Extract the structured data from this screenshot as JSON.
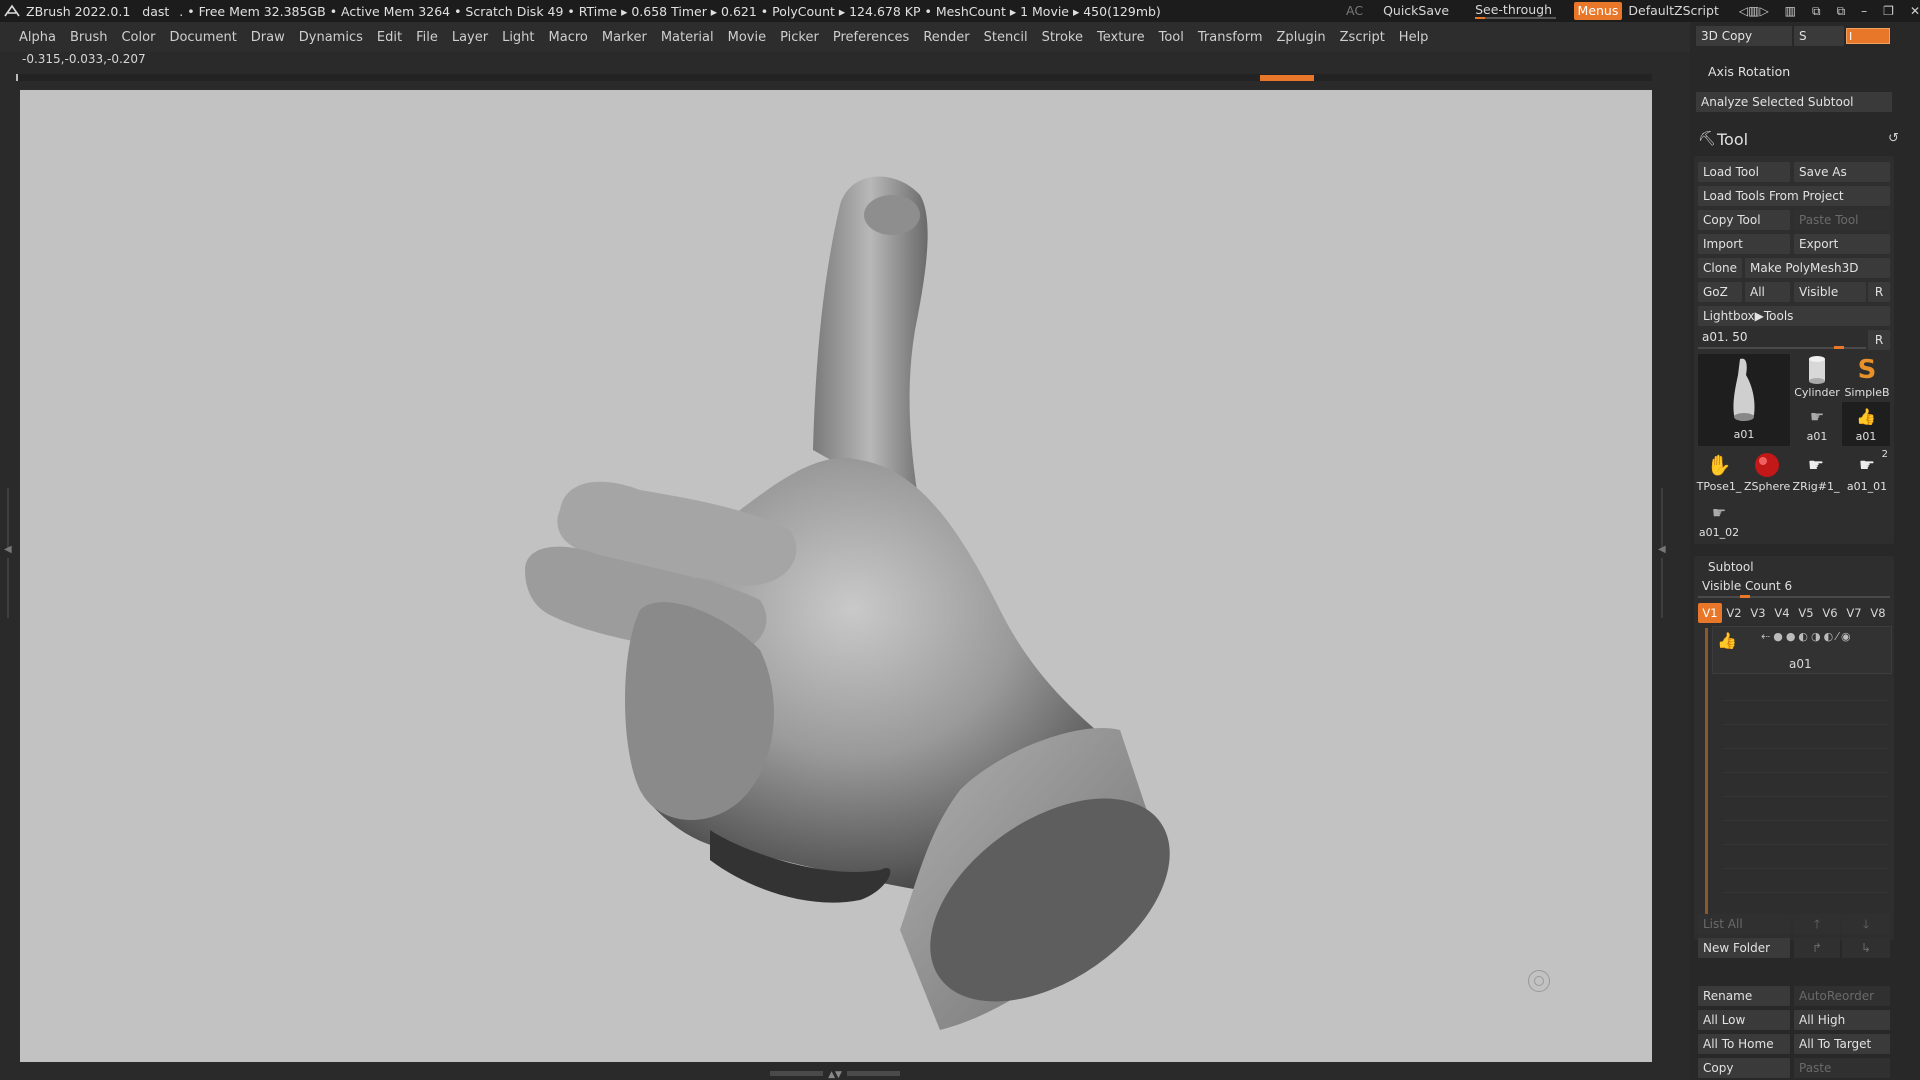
{
  "titlebar": {
    "app_name": "ZBrush 2022.0.1",
    "doc_name": "dast",
    "stats": ". • Free Mem 32.385GB • Active Mem 3264 • Scratch Disk 49 •  RTime ▸ 0.658 Timer ▸ 0.621 • PolyCount ▸ 124.678 KP  • MeshCount ▸ 1  Movie ▸ 450(129mb)",
    "ac": "AC",
    "quicksave": "QuickSave",
    "see_through_label": "See-through",
    "see_through_value": "0",
    "menus": "Menus",
    "zscript": "DefaultZScript"
  },
  "menubar": {
    "items": [
      "Alpha",
      "Brush",
      "Color",
      "Document",
      "Draw",
      "Dynamics",
      "Edit",
      "File",
      "Layer",
      "Light",
      "Macro",
      "Marker",
      "Material",
      "Movie",
      "Picker",
      "Preferences",
      "Render",
      "Stencil",
      "Stroke",
      "Texture",
      "Tool",
      "Transform",
      "Zplugin",
      "Zscript",
      "Help"
    ]
  },
  "coords": "-0.315,-0.033,-0.207",
  "panel": {
    "copy3d": "3D Copy",
    "s_label": "S",
    "i_label": "I",
    "axis_rotation": "Axis Rotation",
    "analyze": "Analyze Selected Subtool",
    "tool_title": "Tool",
    "load_tool": "Load Tool",
    "save_as": "Save As",
    "load_from_project": "Load Tools From Project",
    "copy_tool": "Copy Tool",
    "paste_tool": "Paste Tool",
    "import": "Import",
    "export": "Export",
    "clone": "Clone",
    "make_polymesh": "Make PolyMesh3D",
    "goz": "GoZ",
    "all": "All",
    "visible": "Visible",
    "r": "R",
    "lightbox_tools": "Lightbox▶Tools",
    "tool_slider_label": "a01. 50",
    "thumbs": {
      "main": "a01",
      "cylinder": "Cylinder",
      "simpleb": "SimpleB",
      "a01_small": "a01",
      "a01_small2": "a01",
      "tpose": "TPose1_",
      "zsphere": "ZSphere",
      "zrig": "ZRig#1_",
      "a01_01": "a01_01",
      "a01_01_count": "2",
      "a01_02": "a01_02"
    },
    "subtool_title": "Subtool",
    "visible_count": "Visible Count 6",
    "vtabs": [
      "V1",
      "V2",
      "V3",
      "V4",
      "V5",
      "V6",
      "V7",
      "V8"
    ],
    "subtool_name": "a01",
    "list_all": "List All",
    "new_folder": "New Folder",
    "rename": "Rename",
    "autoreorder": "AutoReorder",
    "all_low": "All Low",
    "all_high": "All High",
    "all_to_home": "All To Home",
    "all_to_target": "All To Target",
    "copy": "Copy",
    "paste": "Paste"
  },
  "colors": {
    "accent": "#e8772a",
    "canvas_bg": "#c2c2c2",
    "panel_bg": "#282828"
  }
}
